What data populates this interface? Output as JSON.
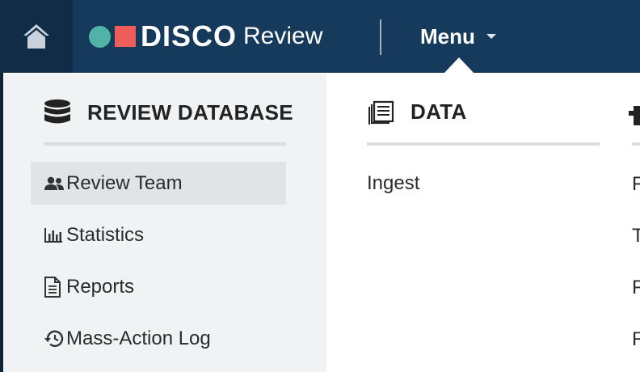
{
  "topbar": {
    "home_icon": "home-icon",
    "logo_word": "DISCO",
    "logo_sub": "Review",
    "brand_colors": {
      "dot": "#4fb3a8",
      "square": "#ef5d5a",
      "bar": "#163a5c"
    },
    "menu_label": "Menu"
  },
  "menu": {
    "review_database": {
      "title": "REVIEW DATABASE",
      "icon": "database-icon",
      "items": [
        {
          "label": "Review Team",
          "icon": "users-icon",
          "active": true
        },
        {
          "label": "Statistics",
          "icon": "bar-chart-icon"
        },
        {
          "label": "Reports",
          "icon": "document-icon"
        },
        {
          "label": "Mass-Action Log",
          "icon": "history-icon"
        }
      ]
    },
    "data": {
      "title": "DATA",
      "icon": "documents-icon",
      "items": [
        {
          "label": "Ingest"
        }
      ]
    },
    "third_column_partial": {
      "items": [
        {
          "label": "F"
        },
        {
          "label": "T"
        },
        {
          "label": "F"
        },
        {
          "label": "R"
        }
      ]
    }
  }
}
